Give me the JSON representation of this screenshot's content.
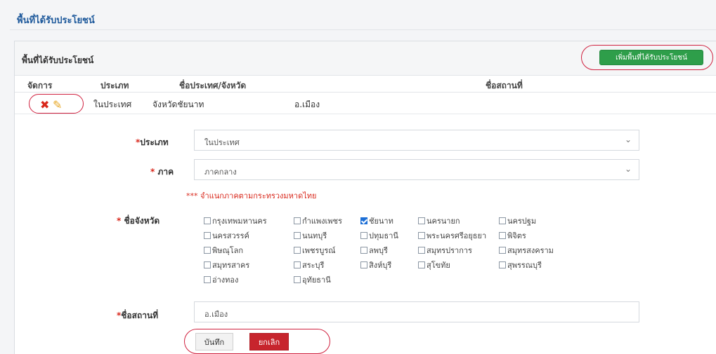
{
  "page": {
    "title": "พื้นที่ได้รับประโยชน์"
  },
  "panel": {
    "title": "พื้นที่ได้รับประโยชน์",
    "add_button": "เพิ่มพื้นที่ได้รับประโยชน์"
  },
  "table": {
    "headers": [
      "จัดการ",
      "ประเภท",
      "ชื่อประเทศ/จังหวัด",
      "ชื่อสถานที่"
    ],
    "rows": [
      {
        "type": "ในประเทศ",
        "province": "จังหวัดชัยนาท",
        "place": "อ.เมือง"
      }
    ]
  },
  "form": {
    "type_label": "ประเภท",
    "type_value": "ในประเทศ",
    "region_label": "ภาค",
    "region_value": "ภาคกลาง",
    "note": "*** จำแนกภาคตามกระทรวงมหาดไทย",
    "province_label": "ชื่อจังหวัด",
    "provinces": [
      {
        "name": "กรุงเทพมหานคร",
        "checked": false
      },
      {
        "name": "กำแพงเพชร",
        "checked": false
      },
      {
        "name": "ชัยนาท",
        "checked": true
      },
      {
        "name": "นครนายก",
        "checked": false
      },
      {
        "name": "นครปฐม",
        "checked": false
      },
      {
        "name": "นครสวรรค์",
        "checked": false
      },
      {
        "name": "นนทบุรี",
        "checked": false
      },
      {
        "name": "ปทุมธานี",
        "checked": false
      },
      {
        "name": "พระนครศรีอยุธยา",
        "checked": false
      },
      {
        "name": "พิจิตร",
        "checked": false
      },
      {
        "name": "พิษณุโลก",
        "checked": false
      },
      {
        "name": "เพชรบูรณ์",
        "checked": false
      },
      {
        "name": "ลพบุรี",
        "checked": false
      },
      {
        "name": "สมุทรปราการ",
        "checked": false
      },
      {
        "name": "สมุทรสงคราม",
        "checked": false
      },
      {
        "name": "สมุทรสาคร",
        "checked": false
      },
      {
        "name": "สระบุรี",
        "checked": false
      },
      {
        "name": "สิงห์บุรี",
        "checked": false
      },
      {
        "name": "สุโขทัย",
        "checked": false
      },
      {
        "name": "สุพรรณบุรี",
        "checked": false
      },
      {
        "name": "อ่างทอง",
        "checked": false
      },
      {
        "name": "อุทัยธานี",
        "checked": false
      }
    ],
    "place_label": "ชื่อสถานที่",
    "place_value": "อ.เมือง",
    "save_button": "บันทึก",
    "cancel_button": "ยกเลิก"
  },
  "icons": {
    "delete": "close-x-icon",
    "edit": "pencil-icon",
    "dropdown": "chevron-down-icon"
  },
  "colors": {
    "accent": "#1f5a9c",
    "success": "#2e9e4a",
    "danger": "#c7252d",
    "highlight": "#d0213f"
  }
}
